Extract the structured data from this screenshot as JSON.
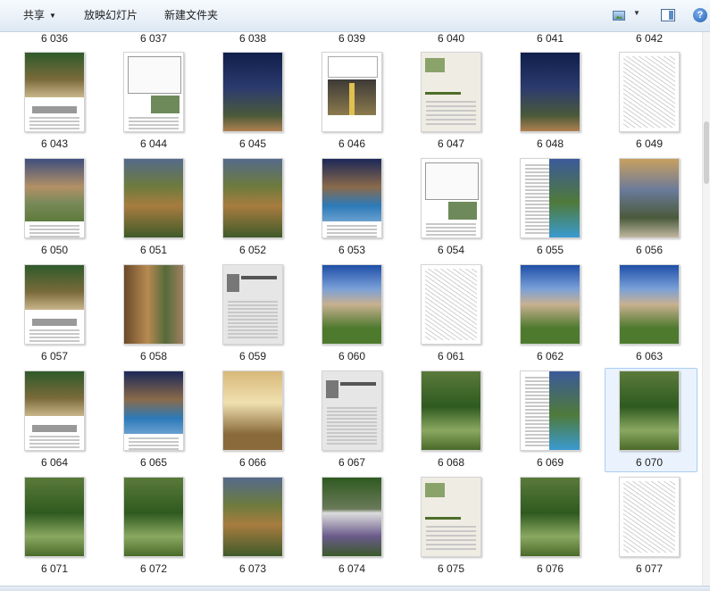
{
  "toolbar": {
    "share_label": "共享",
    "slideshow_label": "放映幻灯片",
    "new_folder_label": "新建文件夹"
  },
  "icons": {
    "view": "change-view-icon",
    "preview_pane": "preview-pane-icon",
    "help": "help-icon"
  },
  "colors": {
    "toolbar_bg": "#e4edf7",
    "selection_bg": "#eaf3fd",
    "selection_border": "#a9cdf2"
  },
  "top_partial_labels": [
    "6 036",
    "6 037",
    "6 038",
    "6 039",
    "6 040",
    "6 041",
    "6 042"
  ],
  "files": [
    {
      "name": "6 043",
      "style": "plan-photo"
    },
    {
      "name": "6 044",
      "style": "drawing"
    },
    {
      "name": "6 045",
      "style": "night-photo"
    },
    {
      "name": "6 046",
      "style": "page-photo"
    },
    {
      "name": "6 047",
      "style": "title-page"
    },
    {
      "name": "6 048",
      "style": "night-photo"
    },
    {
      "name": "6 049",
      "style": "sketch"
    },
    {
      "name": "6 050",
      "style": "villa"
    },
    {
      "name": "6 051",
      "style": "garden"
    },
    {
      "name": "6 052",
      "style": "garden"
    },
    {
      "name": "6 053",
      "style": "pool-night"
    },
    {
      "name": "6 054",
      "style": "drawing"
    },
    {
      "name": "6 055",
      "style": "text-photo"
    },
    {
      "name": "6 056",
      "style": "pergola"
    },
    {
      "name": "6 057",
      "style": "plan-photo"
    },
    {
      "name": "6 058",
      "style": "statue"
    },
    {
      "name": "6 059",
      "style": "text-page"
    },
    {
      "name": "6 060",
      "style": "villa-day"
    },
    {
      "name": "6 061",
      "style": "sketch"
    },
    {
      "name": "6 062",
      "style": "villa-day"
    },
    {
      "name": "6 063",
      "style": "villa-day"
    },
    {
      "name": "6 064",
      "style": "plan-photo"
    },
    {
      "name": "6 065",
      "style": "pool-night"
    },
    {
      "name": "6 066",
      "style": "interior"
    },
    {
      "name": "6 067",
      "style": "text-page"
    },
    {
      "name": "6 068",
      "style": "green"
    },
    {
      "name": "6 069",
      "style": "text-photo"
    },
    {
      "name": "6 070",
      "style": "green",
      "selected": true
    },
    {
      "name": "6 071",
      "style": "green"
    },
    {
      "name": "6 072",
      "style": "green"
    },
    {
      "name": "6 073",
      "style": "garden"
    },
    {
      "name": "6 074",
      "style": "bench"
    },
    {
      "name": "6 075",
      "style": "title-page"
    },
    {
      "name": "6 076",
      "style": "green"
    },
    {
      "name": "6 077",
      "style": "sketch"
    }
  ]
}
